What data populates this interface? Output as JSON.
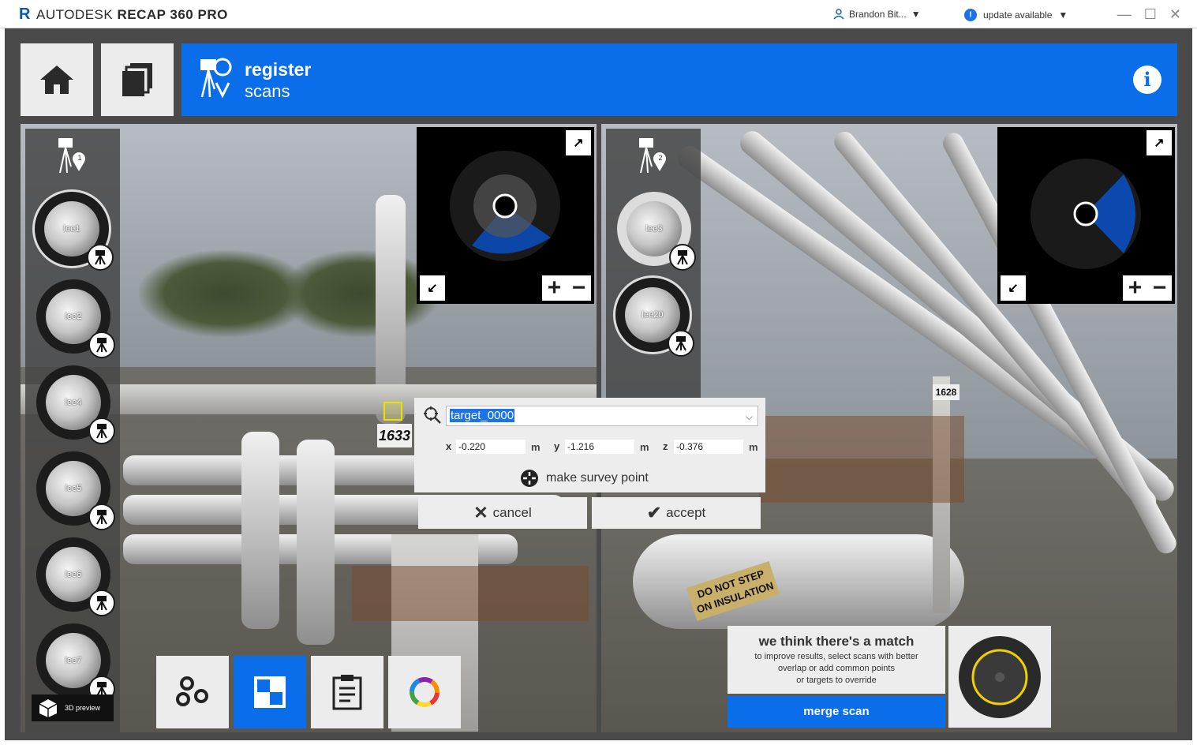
{
  "app": {
    "brand": "AUTODESK",
    "product": "RECAP 360",
    "edition": "PRO",
    "logo_letter": "R"
  },
  "header": {
    "user": "Brandon Bit...",
    "update": "update available"
  },
  "banner": {
    "title": "register",
    "subtitle": "scans",
    "info": "i"
  },
  "left_panel": {
    "badge_num": "1",
    "scans": [
      {
        "label": "lee1",
        "selected": true
      },
      {
        "label": "lee2",
        "selected": false
      },
      {
        "label": "lee4",
        "selected": false
      },
      {
        "label": "lee5",
        "selected": false
      },
      {
        "label": "lee6",
        "selected": false
      },
      {
        "label": "lee7",
        "selected": false
      }
    ],
    "preview_label": "3D preview"
  },
  "right_panel": {
    "badge_num": "2",
    "scans": [
      {
        "label": "lee3",
        "selected": false
      },
      {
        "label": "lee20",
        "selected": true
      }
    ]
  },
  "scene": {
    "left_tag": "1633",
    "right_tag": "1628",
    "sign_line1": "DO NOT STEP",
    "sign_line2": "ON INSULATION"
  },
  "dialog": {
    "target_name": "target_0000",
    "x_label": "x",
    "x_value": "-0.220",
    "y_label": "y",
    "y_value": "-1.216",
    "z_label": "z",
    "z_value": "-0.376",
    "unit": "m",
    "survey_label": "make survey point"
  },
  "actions": {
    "cancel": "cancel",
    "accept": "accept"
  },
  "match": {
    "heading": "we think there's a match",
    "line1": "to improve results, select scans with better",
    "line2": "overlap or add common points",
    "line3": "or targets to override",
    "merge": "merge scan"
  },
  "colors": {
    "accent": "#0a6eea",
    "dial_ring": "#f0d000"
  },
  "icons": [
    "home-icon",
    "pages-icon",
    "register-scans-icon",
    "info-icon",
    "expand-icon",
    "collapse-icon",
    "zoom-in-icon",
    "zoom-out-icon",
    "scanner-icon",
    "cube-icon",
    "nodes-icon",
    "checker-icon",
    "clipboard-icon",
    "color-wheel-icon",
    "target-icon",
    "survey-point-icon"
  ]
}
